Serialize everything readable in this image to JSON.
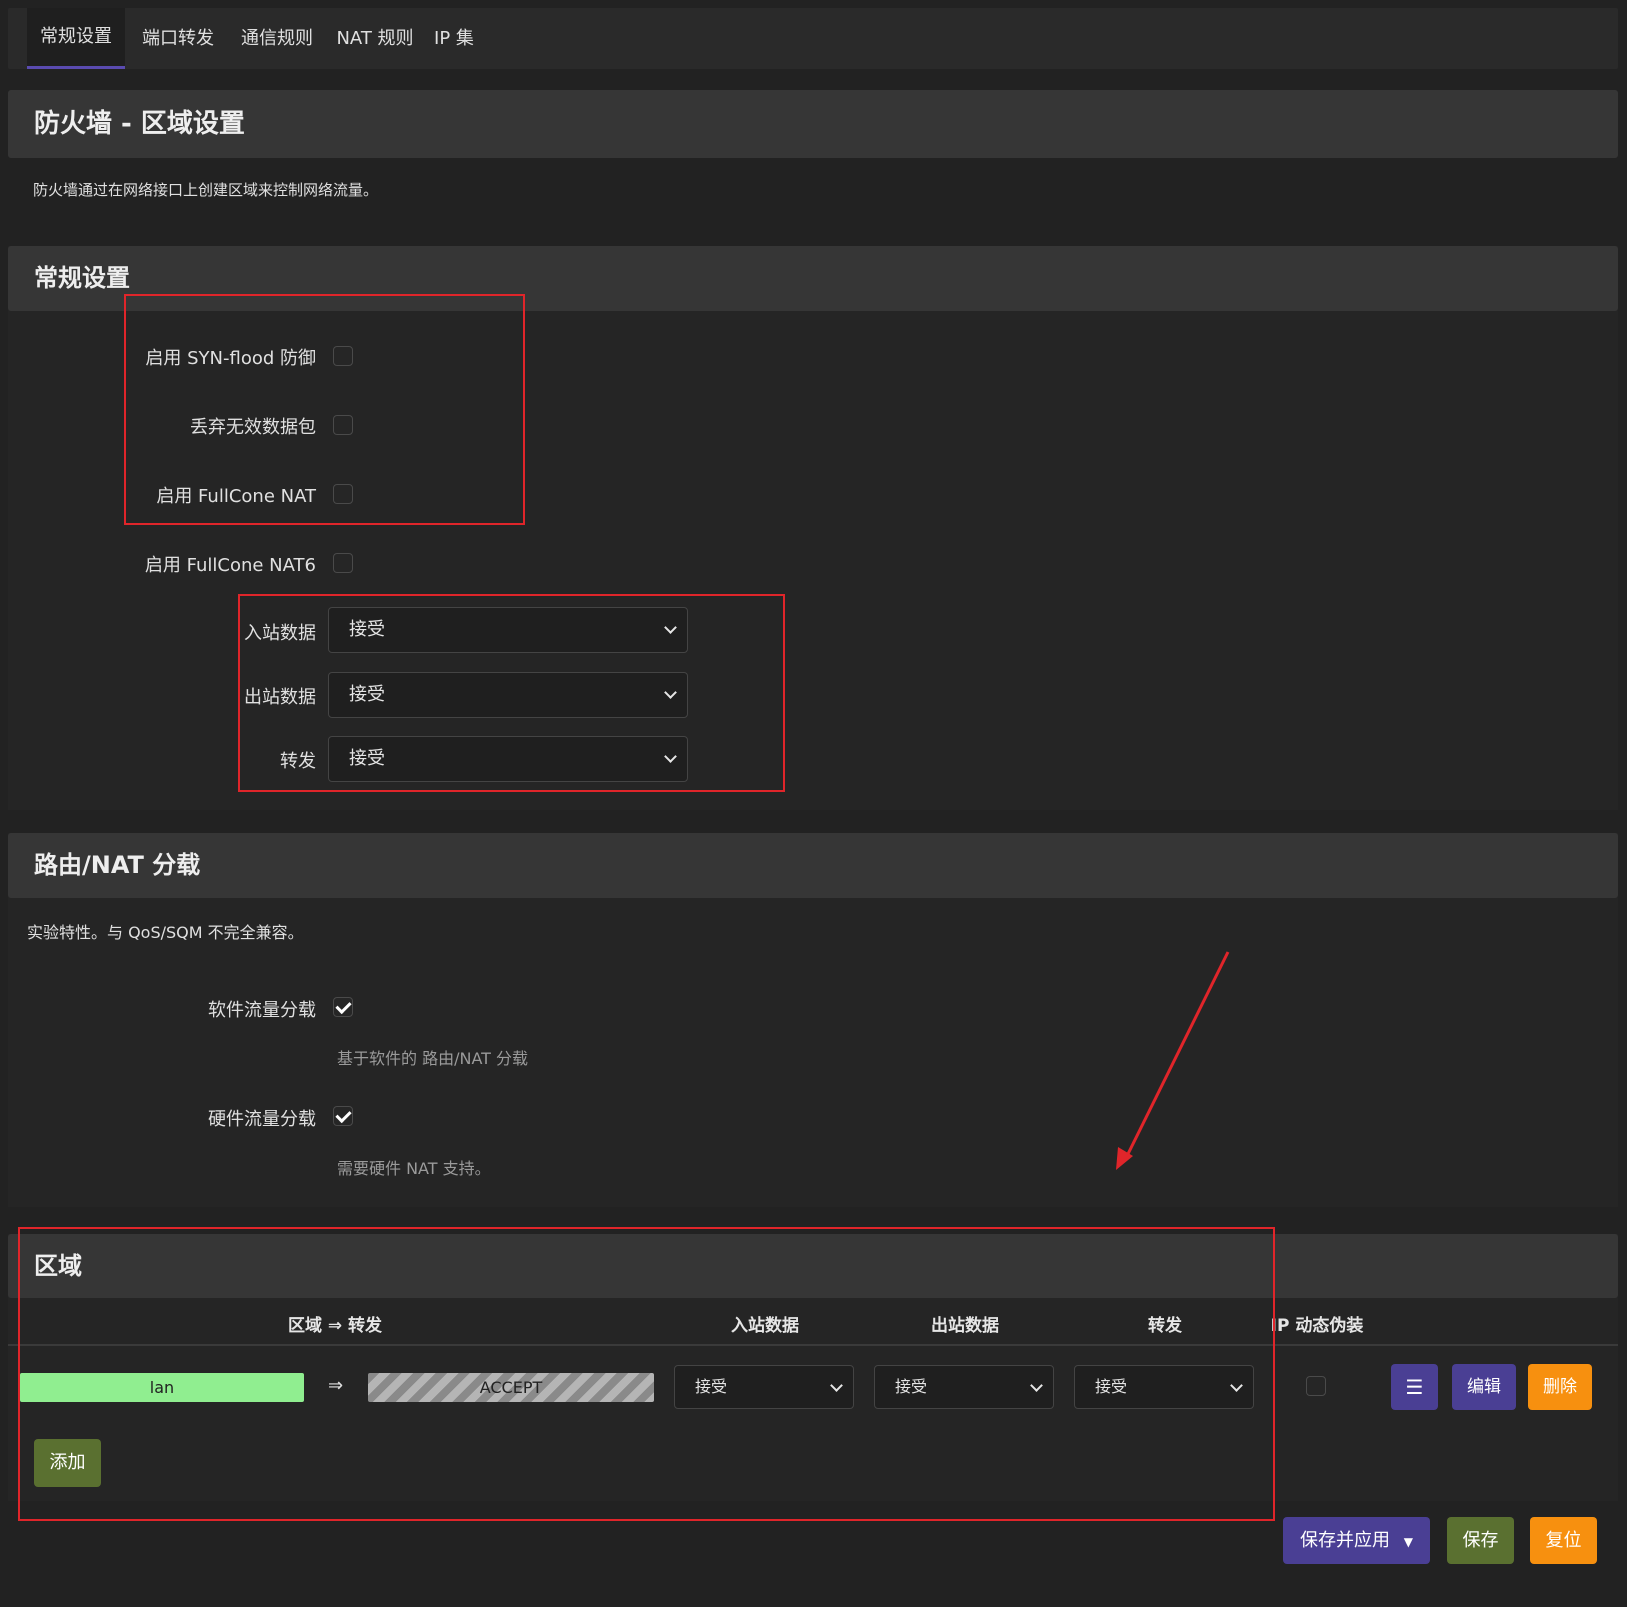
{
  "tabs": [
    "常规设置",
    "端口转发",
    "通信规则",
    "NAT 规则",
    "IP 集"
  ],
  "page": {
    "title": "防火墙 - 区域设置",
    "description": "防火墙通过在网络接口上创建区域来控制网络流量。"
  },
  "general": {
    "title": "常规设置",
    "syn_flood": "启用 SYN-flood 防御",
    "drop_invalid": "丢弃无效数据包",
    "fullcone": "启用 FullCone NAT",
    "fullcone6": "启用 FullCone NAT6",
    "input_label": "入站数据",
    "input_value": "接受",
    "output_label": "出站数据",
    "output_value": "接受",
    "forward_label": "转发",
    "forward_value": "接受"
  },
  "offload": {
    "title": "路由/NAT 分载",
    "description": "实验特性。与 QoS/SQM 不完全兼容。",
    "sw_label": "软件流量分载",
    "sw_hint": "基于软件的 路由/NAT 分载",
    "sw_checked": true,
    "hw_label": "硬件流量分载",
    "hw_hint": "需要硬件 NAT 支持。",
    "hw_checked": true
  },
  "zones": {
    "title": "区域",
    "headers": {
      "zone_forward": "区域 ⇒ 转发",
      "input": "入站数据",
      "output": "出站数据",
      "forward": "转发",
      "masq": "IP 动态伪装"
    },
    "row": {
      "zone": "lan",
      "arrow": "⇒",
      "target": "ACCEPT",
      "input": "接受",
      "output": "接受",
      "forward": "接受",
      "menu_glyph": "☰",
      "edit": "编辑",
      "delete": "删除"
    },
    "add_label": "添加"
  },
  "footer": {
    "save_apply": "保存并应用",
    "save_apply_caret": "▼",
    "save": "保存",
    "reset": "复位"
  },
  "colors": {
    "accent": "#4a3f94",
    "save_green": "#5a7030",
    "reset_orange": "#f7900f",
    "zone_lan": "#90ee90",
    "annotation_red": "#e0252a"
  }
}
